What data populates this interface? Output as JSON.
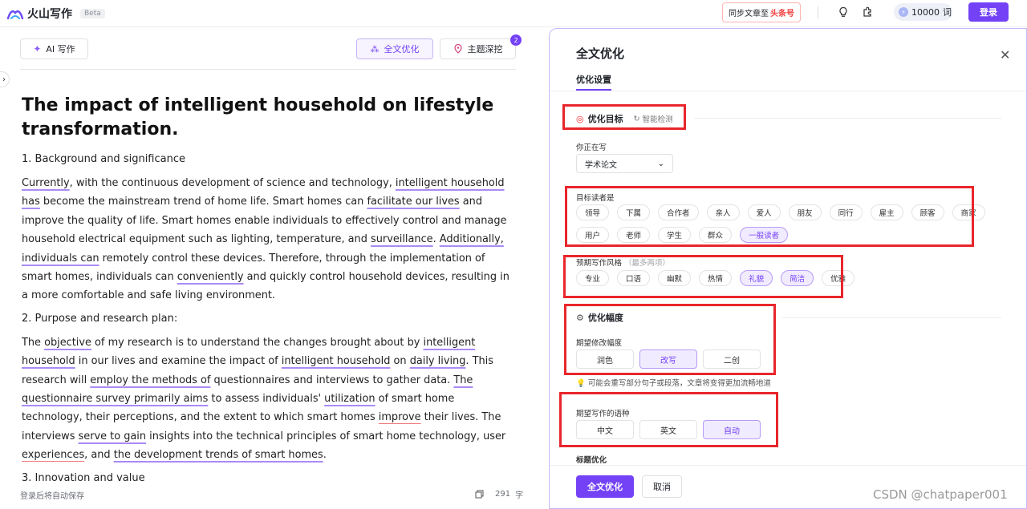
{
  "app": {
    "name": "火山写作",
    "beta": "Beta"
  },
  "topbar": {
    "sync_prefix": "同步文章至",
    "sync_brand": "头条号",
    "credits_value": "10000",
    "credits_unit": "词",
    "login": "登录",
    "accent": "#7442f6"
  },
  "editor": {
    "ai_write": "AI 写作",
    "full_optimize": "全文优化",
    "topic_deep": "主题深挖",
    "topic_badge": "2",
    "title": "The impact of intelligent household on lifestyle transformation.",
    "section1": "1. Background and significance",
    "p1": [
      {
        "t": "Currently",
        "u": "u"
      },
      {
        "t": ", with the continuous development of science and technology, "
      },
      {
        "t": "intelligent household has",
        "u": "u"
      },
      {
        "t": " become the mainstream trend of home life. Smart homes can "
      },
      {
        "t": "facilitate our lives",
        "u": "u"
      },
      {
        "t": " and improve the quality of life. Smart homes enable individuals to effectively control and manage household electrical equipment such as lighting, temperature, and "
      },
      {
        "t": "surveillance",
        "u": "u"
      },
      {
        "t": ". "
      },
      {
        "t": "Additionally, individuals can",
        "u": "u"
      },
      {
        "t": " remotely control these devices. Therefore, through the implementation of smart homes, individuals can "
      },
      {
        "t": "conveniently",
        "u": "u"
      },
      {
        "t": " and quickly control household devices, resulting in a more comfortable and safe living environment."
      }
    ],
    "section2": "2. Purpose and research plan:",
    "p2": [
      {
        "t": "The "
      },
      {
        "t": "objective",
        "u": "u"
      },
      {
        "t": " of my research is to understand the changes brought about by "
      },
      {
        "t": "intelligent household",
        "u": "u"
      },
      {
        "t": " in our lives and examine the impact of "
      },
      {
        "t": "intelligent household",
        "u": "u"
      },
      {
        "t": " on "
      },
      {
        "t": "daily living",
        "u": "u"
      },
      {
        "t": ". This research will "
      },
      {
        "t": "employ the methods of",
        "u": "u"
      },
      {
        "t": " questionnaires and interviews to gather data. "
      },
      {
        "t": "The questionnaire survey primarily aims",
        "u": "u"
      },
      {
        "t": " to assess individuals' "
      },
      {
        "t": "utilization",
        "u": "u"
      },
      {
        "t": " of smart home technology, their perceptions, and the extent to which smart homes "
      },
      {
        "t": "improve",
        "u": "ur"
      },
      {
        "t": " their lives. The interviews "
      },
      {
        "t": "serve to gain",
        "u": "u"
      },
      {
        "t": " insights into the technical principles of smart home technology, user "
      },
      {
        "t": "experiences",
        "u": "ur"
      },
      {
        "t": ", and "
      },
      {
        "t": "the development trends of smart homes",
        "u": "u"
      },
      {
        "t": "."
      }
    ],
    "section3_partial": "3. Innovation and value",
    "footer_left": "登录后将自动保存",
    "word_count": "291",
    "word_unit": "字"
  },
  "panel": {
    "title": "全文优化",
    "tab": "优化设置",
    "goal_title": "优化目标",
    "smart_detect": "智能检测",
    "writing_label": "你正在写",
    "writing_value": "学术论文",
    "audience_label": "目标读者是",
    "audiences": [
      {
        "label": "领导",
        "selected": false
      },
      {
        "label": "下属",
        "selected": false
      },
      {
        "label": "合作者",
        "selected": false
      },
      {
        "label": "亲人",
        "selected": false
      },
      {
        "label": "爱人",
        "selected": false
      },
      {
        "label": "朋友",
        "selected": false
      },
      {
        "label": "同行",
        "selected": false
      },
      {
        "label": "雇主",
        "selected": false
      },
      {
        "label": "顾客",
        "selected": false
      },
      {
        "label": "商家",
        "selected": false
      },
      {
        "label": "用户",
        "selected": false
      },
      {
        "label": "老师",
        "selected": false
      },
      {
        "label": "学生",
        "selected": false
      },
      {
        "label": "群众",
        "selected": false
      },
      {
        "label": "一般读者",
        "selected": true
      }
    ],
    "style_label": "预期写作风格",
    "style_hint": "（最多两项）",
    "styles": [
      {
        "label": "专业",
        "selected": false
      },
      {
        "label": "口语",
        "selected": false
      },
      {
        "label": "幽默",
        "selected": false
      },
      {
        "label": "热情",
        "selected": false
      },
      {
        "label": "礼貌",
        "selected": true
      },
      {
        "label": "简洁",
        "selected": true
      },
      {
        "label": "优雅",
        "selected": false
      }
    ],
    "range_title": "优化幅度",
    "range_label": "期望修改幅度",
    "ranges": [
      {
        "label": "润色",
        "selected": false
      },
      {
        "label": "改写",
        "selected": true
      },
      {
        "label": "二创",
        "selected": false
      }
    ],
    "range_hint": "可能会重写部分句子或段落，文章将变得更加流畅地道",
    "lang_label": "期望写作的语种",
    "langs": [
      {
        "label": "中文",
        "selected": false
      },
      {
        "label": "英文",
        "selected": false
      },
      {
        "label": "自动",
        "selected": true
      }
    ],
    "title_opt": "标题优化",
    "confirm": "全文优化",
    "cancel": "取消"
  },
  "watermark": "CSDN @chatpaper001"
}
